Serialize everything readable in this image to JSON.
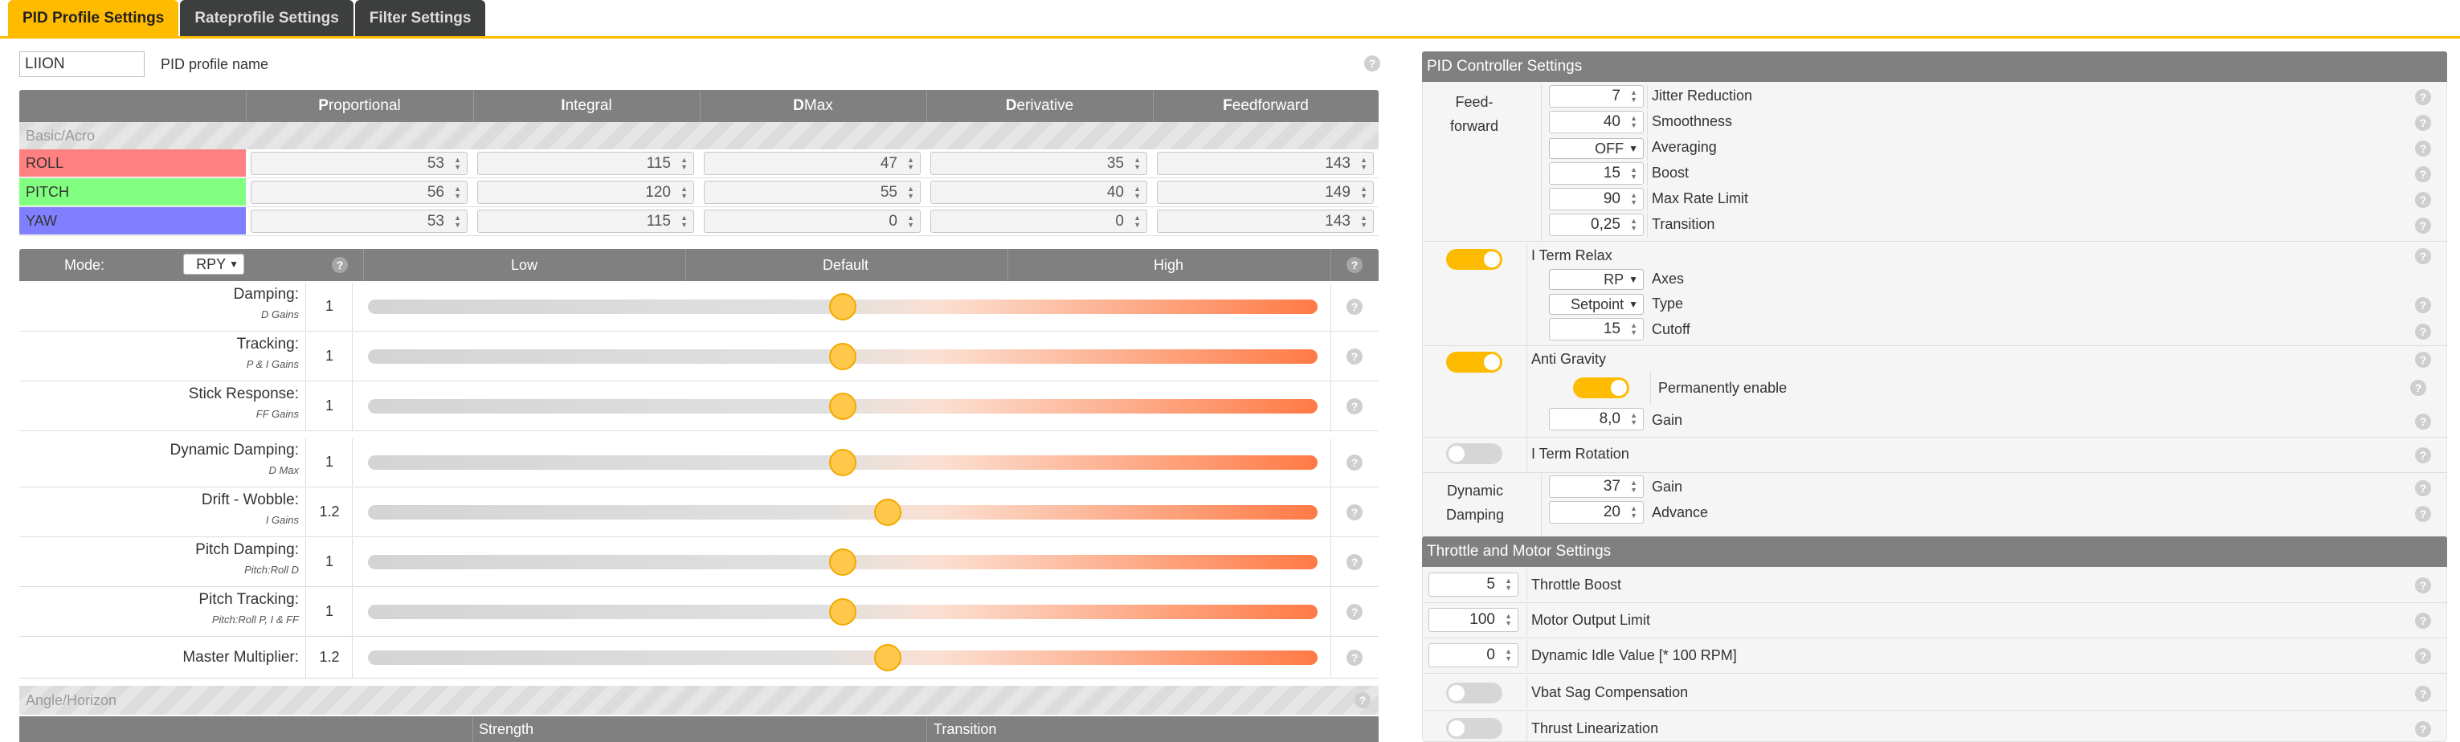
{
  "tabs": [
    "PID Profile Settings",
    "Rateprofile Settings",
    "Filter Settings"
  ],
  "profile": {
    "name": "LIION",
    "label": "PID profile name"
  },
  "pid_table": {
    "headers": [
      {
        "first": "P",
        "rest": "roportional"
      },
      {
        "first": "I",
        "rest": "ntegral"
      },
      {
        "first": "D",
        "rest": " Max"
      },
      {
        "first": "D",
        "rest": "erivative"
      },
      {
        "first": "F",
        "rest": "eedforward"
      }
    ],
    "section": "Basic/Acro",
    "rows": [
      {
        "axis": "ROLL",
        "color": "#ff8080",
        "values": [
          "53",
          "115",
          "47",
          "35",
          "143"
        ]
      },
      {
        "axis": "PITCH",
        "color": "#80ff80",
        "values": [
          "56",
          "120",
          "55",
          "40",
          "149"
        ]
      },
      {
        "axis": "YAW",
        "color": "#8080ff",
        "values": [
          "53",
          "115",
          "0",
          "0",
          "143"
        ]
      }
    ]
  },
  "sliders": {
    "mode_label": "Mode:",
    "mode_value": "RPY",
    "columns": [
      "Low",
      "Default",
      "High"
    ],
    "rows": [
      {
        "name": "Damping:",
        "sub": "D Gains",
        "value": "1",
        "level": 0.5
      },
      {
        "name": "Tracking:",
        "sub": "P & I Gains",
        "value": "1",
        "level": 0.5
      },
      {
        "name": "Stick Response:",
        "sub": "FF Gains",
        "value": "1",
        "level": 0.5
      },
      {
        "name": "Dynamic Damping:",
        "sub": "D Max",
        "value": "1",
        "level": 0.5
      },
      {
        "name": "Drift - Wobble:",
        "sub": "I Gains",
        "value": "1.2",
        "level": 0.6
      },
      {
        "name": "Pitch Damping:",
        "sub": "Pitch:Roll D",
        "value": "1",
        "level": 0.5
      },
      {
        "name": "Pitch Tracking:",
        "sub": "Pitch:Roll P, I & FF",
        "value": "1",
        "level": 0.5
      },
      {
        "name": "Master Multiplier:",
        "sub": "",
        "value": "1.2",
        "level": 0.6
      }
    ]
  },
  "angle": {
    "section": "Angle/Horizon",
    "cols": [
      "Strength",
      "Transition"
    ]
  },
  "pid_controller": {
    "title": "PID Controller Settings",
    "feedforward_label": "Feed-\nforward",
    "feedforward": [
      {
        "value": "7",
        "label": "Jitter Reduction"
      },
      {
        "value": "40",
        "label": "Smoothness"
      },
      {
        "value": "OFF",
        "label": "Averaging",
        "select": true
      },
      {
        "value": "15",
        "label": "Boost"
      },
      {
        "value": "90",
        "label": "Max Rate Limit"
      },
      {
        "value": "0,25",
        "label": "Transition"
      }
    ],
    "iterm_relax": {
      "label": "I Term Relax",
      "on": true,
      "axes": "RP",
      "axes_label": "Axes",
      "type": "Setpoint",
      "type_label": "Type",
      "cutoff": "15",
      "cutoff_label": "Cutoff"
    },
    "anti_gravity": {
      "label": "Anti Gravity",
      "on": true,
      "perm_label": "Permanently enable",
      "perm_on": true,
      "gain": "8,0",
      "gain_label": "Gain"
    },
    "iterm_rotation": {
      "label": "I Term Rotation",
      "on": false
    },
    "dynamic_damping": {
      "label": "Dynamic\nDamping",
      "gain": "37",
      "gain_label": "Gain",
      "advance": "20",
      "advance_label": "Advance"
    }
  },
  "throttle": {
    "title": "Throttle and Motor Settings",
    "rows": [
      {
        "value": "5",
        "label": "Throttle Boost"
      },
      {
        "value": "100",
        "label": "Motor Output Limit"
      },
      {
        "value": "0",
        "label": "Dynamic Idle Value [* 100 RPM]"
      }
    ],
    "vbat_label": "Vbat Sag Compensation",
    "vbat_on": false,
    "thrust_label": "Thrust Linearization",
    "thrust_on": false
  }
}
